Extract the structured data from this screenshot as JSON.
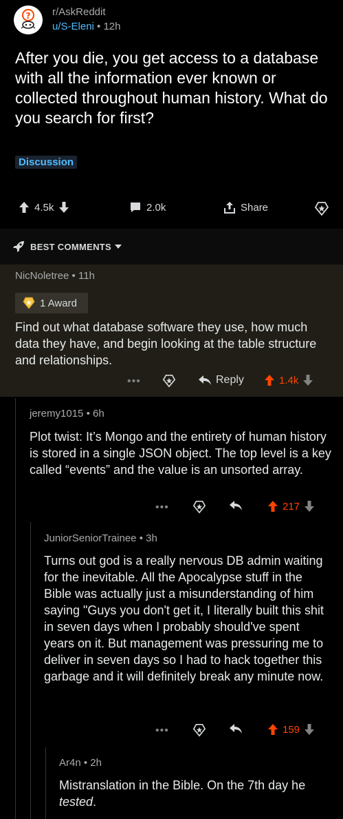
{
  "post": {
    "subreddit": "r/AskReddit",
    "author": "u/S-Eleni",
    "time": "12h",
    "title": "After you die, you get access to a database with all the information ever known or collected throughout human history. What do you search for first?",
    "flair": "Discussion",
    "votes": "4.5k",
    "comments": "2.0k",
    "share_label": "Share"
  },
  "sort": {
    "label": "BEST COMMENTS"
  },
  "comments": [
    {
      "author": "NicNoletree",
      "time": "11h",
      "award": "1 Award",
      "body": "Find out what database software they use, how much data they have, and begin looking at the table structure and relationships.",
      "reply_label": "Reply",
      "votes": "1.4k"
    },
    {
      "author": "jeremy1015",
      "time": "6h",
      "body": "Plot twist: It’s Mongo and the entirety of human history is stored in a single JSON object. The top level is a key called “events” and the value is an unsorted array.",
      "votes": "217"
    },
    {
      "author": "JuniorSeniorTrainee",
      "time": "3h",
      "body": "Turns out god is a really nervous DB admin waiting for the inevitable. All the Apocalypse stuff in the Bible was actually just a misunderstanding of him saying \"Guys you don't get it, I literally built this shit in seven days when I probably should've spent years on it. But management was pressuring me to deliver in seven days so I had to hack together this garbage and it will definitely break any minute now.",
      "votes": "159"
    },
    {
      "author": "Ar4n",
      "time": "2h",
      "body_start": "Mistranslation in the Bible. On the 7th day he ",
      "body_em": "tested",
      "body_end": "."
    }
  ],
  "icons": [
    "reddit-avatar-icon",
    "upvote-icon",
    "downvote-icon",
    "comment-icon",
    "share-icon",
    "save-icon",
    "rocket-icon",
    "chevron-down-icon",
    "award-icon",
    "reply-icon",
    "more-icon"
  ],
  "colors": {
    "accent_orange": "#ff4500",
    "link_blue": "#4fbcff",
    "award_bg": "#201e16"
  }
}
